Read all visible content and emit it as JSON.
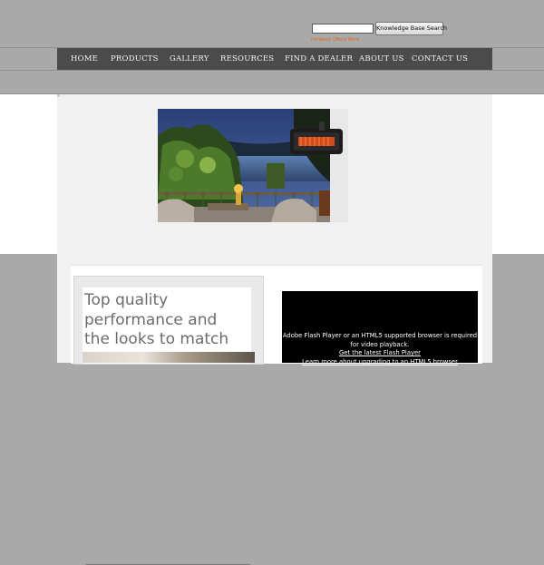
{
  "header": {
    "search": {
      "value": "",
      "button_label": "Knowledge Base Search"
    },
    "tagline": "Infratech Offers More"
  },
  "nav": {
    "items": [
      {
        "label": "HOME"
      },
      {
        "label": "PRODUCTS"
      },
      {
        "label": "GALLERY"
      },
      {
        "label": "RESOURCES"
      },
      {
        "label": "FIND A DEALER"
      },
      {
        "label": "ABOUT US"
      },
      {
        "label": "CONTACT US"
      }
    ]
  },
  "promo": {
    "lines": [
      "Top quality",
      "performance and",
      "the looks to match"
    ]
  },
  "video": {
    "message": "Adobe Flash Player or an HTML5 supported browser is required for video playback.",
    "link1": "Get the latest Flash Player",
    "link2": "Learn more about upgrading to an HTML5 browser"
  },
  "colors": {
    "page_bg": "#a9a9a9",
    "nav_bg": "#4b4b4b",
    "content_bg": "#f1f1f1",
    "accent_orange": "#e06a16"
  }
}
